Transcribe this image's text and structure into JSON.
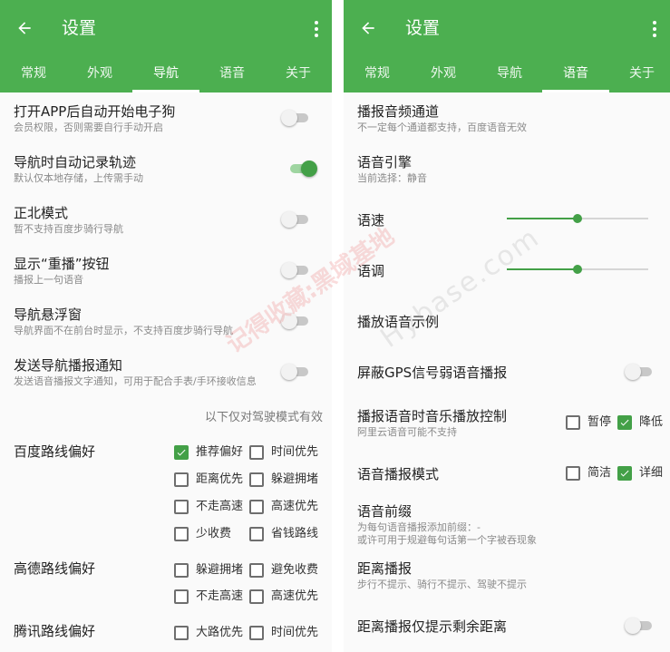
{
  "left": {
    "title": "设置",
    "tabs": [
      "常规",
      "外观",
      "导航",
      "语音",
      "关于"
    ],
    "active_tab": 2,
    "rows": [
      {
        "title": "打开APP后自动开始电子狗",
        "subtitle": "会员权限，否则需要自行手动开启",
        "on": false
      },
      {
        "title": "导航时自动记录轨迹",
        "subtitle": "默认仅本地存储，上传需手动",
        "on": true
      },
      {
        "title": "正北模式",
        "subtitle": "暂不支持百度步骑行导航",
        "on": false
      },
      {
        "title": "显示“重播”按钮",
        "subtitle": "播报上一句语音",
        "on": false
      },
      {
        "title": "导航悬浮窗",
        "subtitle": "导航界面不在前台时显示，不支持百度步骑行导航",
        "on": false
      },
      {
        "title": "发送导航播报通知",
        "subtitle": "发送语音播报文字通知，可用于配合手表/手环接收信息",
        "on": false
      }
    ],
    "note": "以下仅对驾驶模式有效",
    "groups": [
      {
        "title": "百度路线偏好",
        "options": [
          {
            "label": "推荐偏好",
            "checked": true
          },
          {
            "label": "时间优先",
            "checked": false
          },
          {
            "label": "距离优先",
            "checked": false
          },
          {
            "label": "躲避拥堵",
            "checked": false
          },
          {
            "label": "不走高速",
            "checked": false
          },
          {
            "label": "高速优先",
            "checked": false
          },
          {
            "label": "少收费",
            "checked": false
          },
          {
            "label": "省钱路线",
            "checked": false
          }
        ]
      },
      {
        "title": "高德路线偏好",
        "options": [
          {
            "label": "躲避拥堵",
            "checked": false
          },
          {
            "label": "避免收费",
            "checked": false
          },
          {
            "label": "不走高速",
            "checked": false
          },
          {
            "label": "高速优先",
            "checked": false
          }
        ]
      },
      {
        "title": "腾讯路线偏好",
        "options": [
          {
            "label": "大路优先",
            "checked": false
          },
          {
            "label": "时间优先",
            "checked": false
          }
        ]
      }
    ]
  },
  "right": {
    "title": "设置",
    "tabs": [
      "常规",
      "外观",
      "导航",
      "语音",
      "关于"
    ],
    "active_tab": 3,
    "channel": {
      "title": "播报音频通道",
      "subtitle": "不一定每个通道都支持，百度语音无效"
    },
    "engine": {
      "title": "语音引擎",
      "subtitle": "当前选择：静音"
    },
    "speed": {
      "label": "语速",
      "level": 0.5
    },
    "pitch": {
      "label": "语调",
      "level": 0.5
    },
    "sample": "播放语音示例",
    "gps_mute": {
      "title": "屏蔽GPS信号弱语音播报",
      "on": false
    },
    "music_ctrl": {
      "title": "播报语音时音乐播放控制",
      "subtitle": "阿里云语音可能不支持",
      "options": [
        {
          "label": "暂停",
          "checked": false
        },
        {
          "label": "降低",
          "checked": true
        }
      ]
    },
    "mode": {
      "title": "语音播报模式",
      "options": [
        {
          "label": "简洁",
          "checked": false
        },
        {
          "label": "详细",
          "checked": true
        }
      ]
    },
    "prefix": {
      "title": "语音前缀",
      "subtitle1": "为每句语音播报添加前缀：-",
      "subtitle2": "或许可用于规避每句话第一个字被吞现象"
    },
    "distance": {
      "title": "距离播报",
      "subtitle": "步行不提示、骑行不提示、驾驶不提示"
    },
    "remaining": {
      "title": "距离播报仅提示剩余距离",
      "on": false
    }
  },
  "watermark": {
    "cn": "记得收藏:黑域基地",
    "en": "Hybase.com"
  },
  "colors": {
    "primary": "#4caf50",
    "accent": "#43a047"
  }
}
